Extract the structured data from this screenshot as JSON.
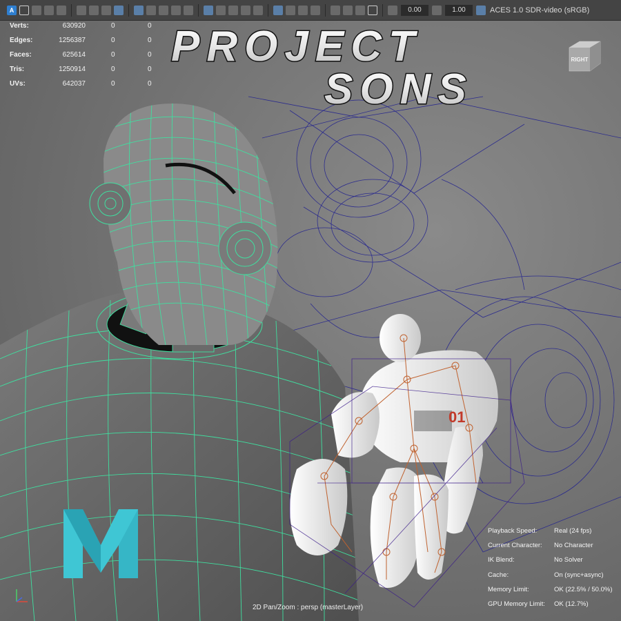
{
  "toolbar": {
    "icons": [
      "select-mode-icon",
      "grid-icon",
      "film-icon",
      "film-gate-icon",
      "camera-icon",
      "camera-attributes-icon",
      "bookmark-icon",
      "image-plane-icon",
      "pencil-icon",
      "two-panes-icon",
      "wireframe-icon",
      "smooth-shade-icon",
      "textured-icon",
      "use-lights-icon",
      "shadows-icon",
      "isolate-icon",
      "xray-icon",
      "xray-joints-icon",
      "resolution-gate-icon",
      "field-chart-icon",
      "safe-action-icon"
    ],
    "exposure_value": "0.00",
    "gamma_value": "1.00",
    "color_management_label": "ACES 1.0 SDR-video (sRGB)"
  },
  "hud": {
    "rows": [
      {
        "label": "Verts:",
        "v1": "630920",
        "v2": "0",
        "v3": "0"
      },
      {
        "label": "Edges:",
        "v1": "1256387",
        "v2": "0",
        "v3": "0"
      },
      {
        "label": "Faces:",
        "v1": "625614",
        "v2": "0",
        "v3": "0"
      },
      {
        "label": "Tris:",
        "v1": "1250914",
        "v2": "0",
        "v3": "0"
      },
      {
        "label": "UVs:",
        "v1": "642037",
        "v2": "0",
        "v3": "0"
      }
    ]
  },
  "overlay": {
    "title_line1": "PROJECT",
    "title_line2": "SONS"
  },
  "viewcube": {
    "face_label": "RIGHT"
  },
  "stats": {
    "rows": [
      {
        "label": "Playback Speed:",
        "value": "Real (24 fps)"
      },
      {
        "label": "Current Character:",
        "value": "No Character"
      },
      {
        "label": "IK Blend:",
        "value": "No Solver"
      },
      {
        "label": "Cache:",
        "value": "On (sync+async)"
      },
      {
        "label": "Memory Limit:",
        "value": "OK (22.5% / 50.0%)"
      },
      {
        "label": "GPU Memory Limit:",
        "value": "OK (12.7%)"
      }
    ]
  },
  "camera_label": "2D Pan/Zoom : persp (masterLayer)",
  "colors": {
    "wire_green": "#3fe0a0",
    "wire_blue": "#23238f",
    "skeleton": "#c0622f",
    "logo_teal": "#3fc6d4"
  }
}
